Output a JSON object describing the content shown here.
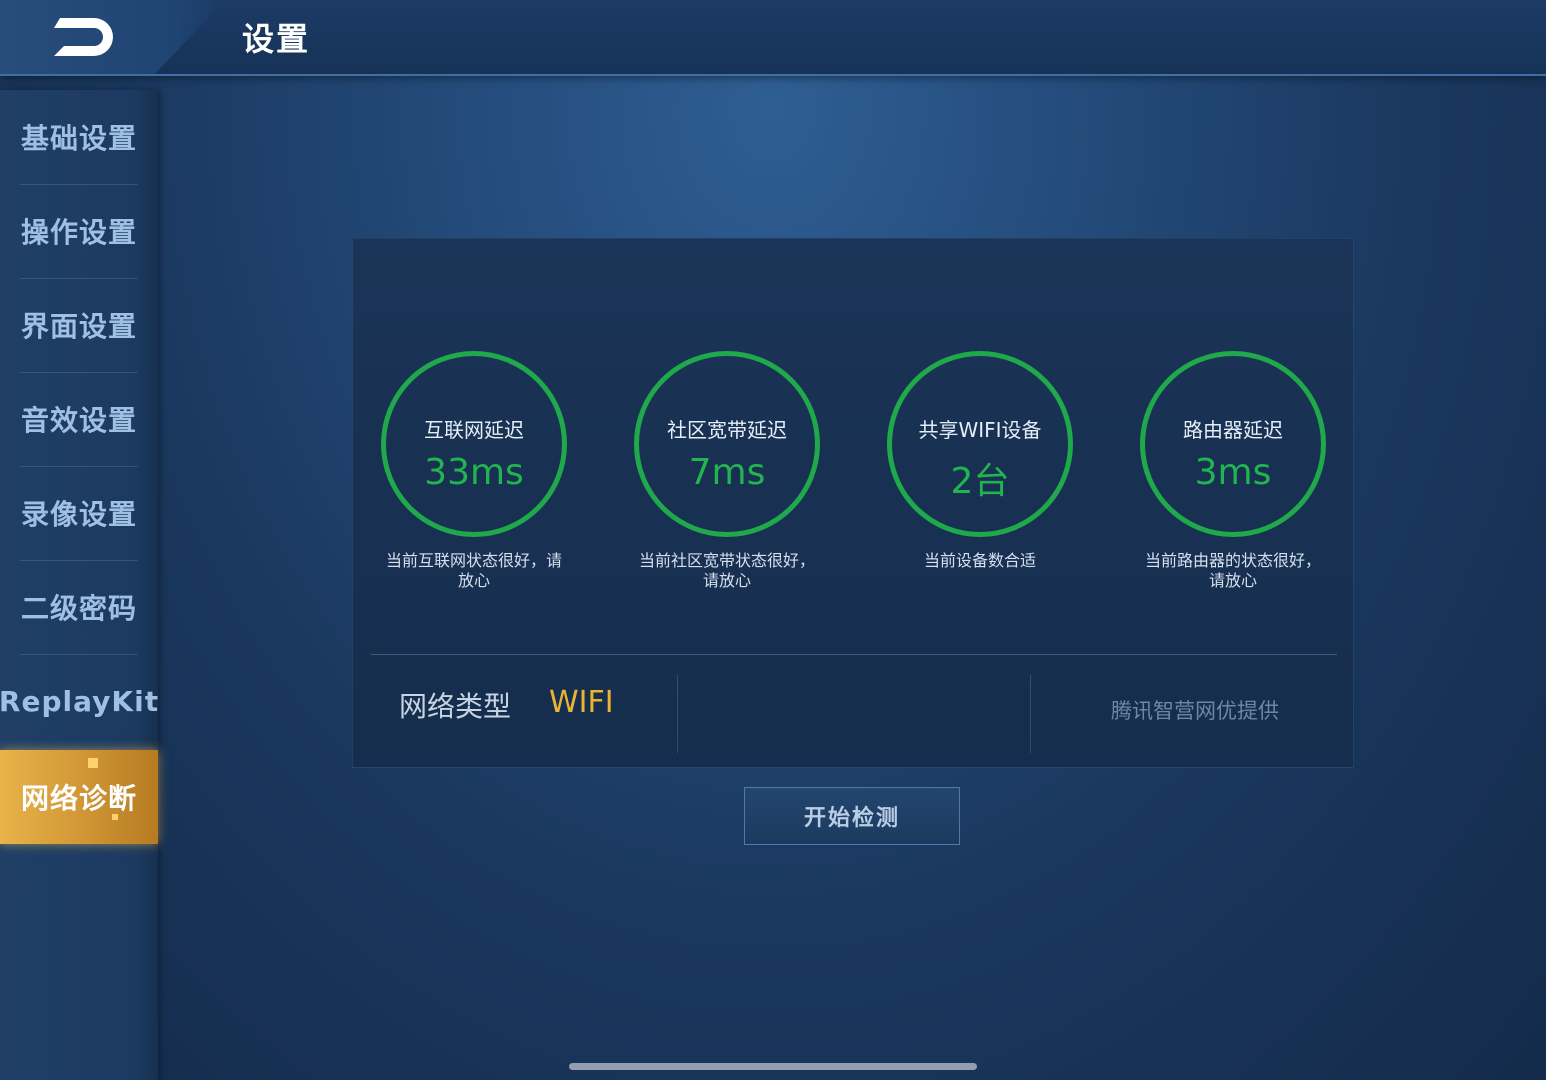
{
  "header": {
    "title": "设置",
    "back_icon": "back-arrow-icon"
  },
  "sidebar": {
    "items": [
      {
        "label": "基础设置"
      },
      {
        "label": "操作设置"
      },
      {
        "label": "界面设置"
      },
      {
        "label": "音效设置"
      },
      {
        "label": "录像设置"
      },
      {
        "label": "二级密码"
      },
      {
        "label": "ReplayKit"
      },
      {
        "label": "网络诊断",
        "active": true
      }
    ]
  },
  "diagnostics": {
    "metrics": [
      {
        "title": "互联网延迟",
        "value": "33ms",
        "desc_line1": "当前互联网状态很好，请",
        "desc_line2": "放心"
      },
      {
        "title": "社区宽带延迟",
        "value": "7ms",
        "desc_line1": "当前社区宽带状态很好，",
        "desc_line2": "请放心"
      },
      {
        "title": "共享WIFI设备",
        "value": "2台",
        "desc_line1": "当前设备数合适",
        "desc_line2": ""
      },
      {
        "title": "路由器延迟",
        "value": "3ms",
        "desc_line1": "当前路由器的状态很好，",
        "desc_line2": "请放心"
      }
    ],
    "network_type_label": "网络类型",
    "network_type_value": "WIFI",
    "provider": "腾讯智营网优提供"
  },
  "start_button": {
    "label": "开始检测"
  },
  "colors": {
    "ring_green": "#1fa94a",
    "value_green": "#20b54e",
    "wifi_yellow": "#e9b431",
    "active_tab_gold": "#d49b38"
  }
}
